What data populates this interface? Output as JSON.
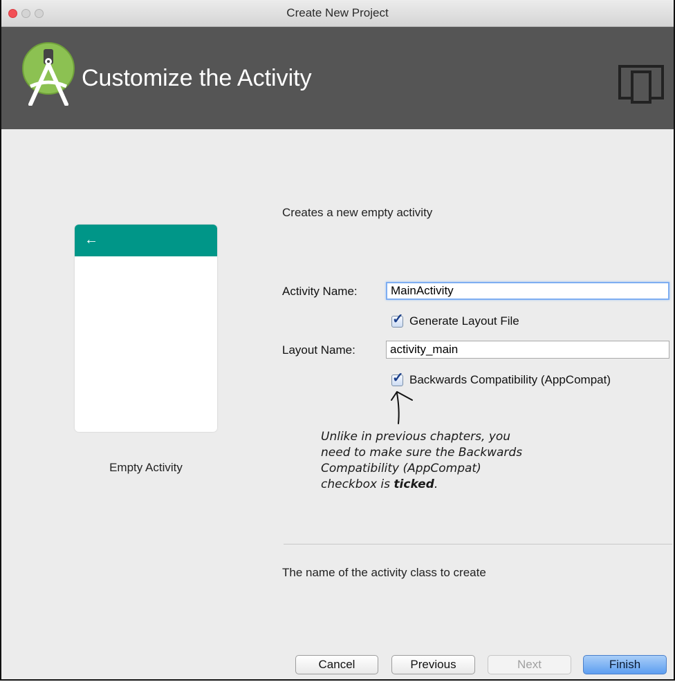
{
  "window": {
    "title": "Create New Project"
  },
  "header": {
    "title": "Customize the Activity",
    "logo_icon": "android-studio-logo-icon",
    "device_icon": "device-form-factor-icon"
  },
  "template": {
    "description": "Creates a new empty activity",
    "preview_label": "Empty Activity",
    "preview_toolbar_color": "#009688",
    "back_icon_glyph": "←"
  },
  "form": {
    "activity_name_label": "Activity Name:",
    "activity_name_value": "MainActivity",
    "generate_layout_label": "Generate Layout File",
    "generate_layout_checked": true,
    "layout_name_label": "Layout Name:",
    "layout_name_value": "activity_main",
    "backwards_compat_label": "Backwards Compatibility (AppCompat)",
    "backwards_compat_checked": true
  },
  "annotation": {
    "lines": [
      "Unlike in previous chapters, you",
      "need to make sure the Backwards",
      "Compatibility (AppCompat)"
    ],
    "last_line_prefix": "checkbox is ",
    "last_line_emphasis": "ticked",
    "last_line_suffix": "."
  },
  "help_text": "The name of the activity class to create",
  "buttons": {
    "cancel": "Cancel",
    "previous": "Previous",
    "next": "Next",
    "finish": "Finish",
    "next_enabled": false
  },
  "colors": {
    "header_bg": "#555555",
    "accent": "#009688",
    "primary_button": "#5d9ef0"
  }
}
